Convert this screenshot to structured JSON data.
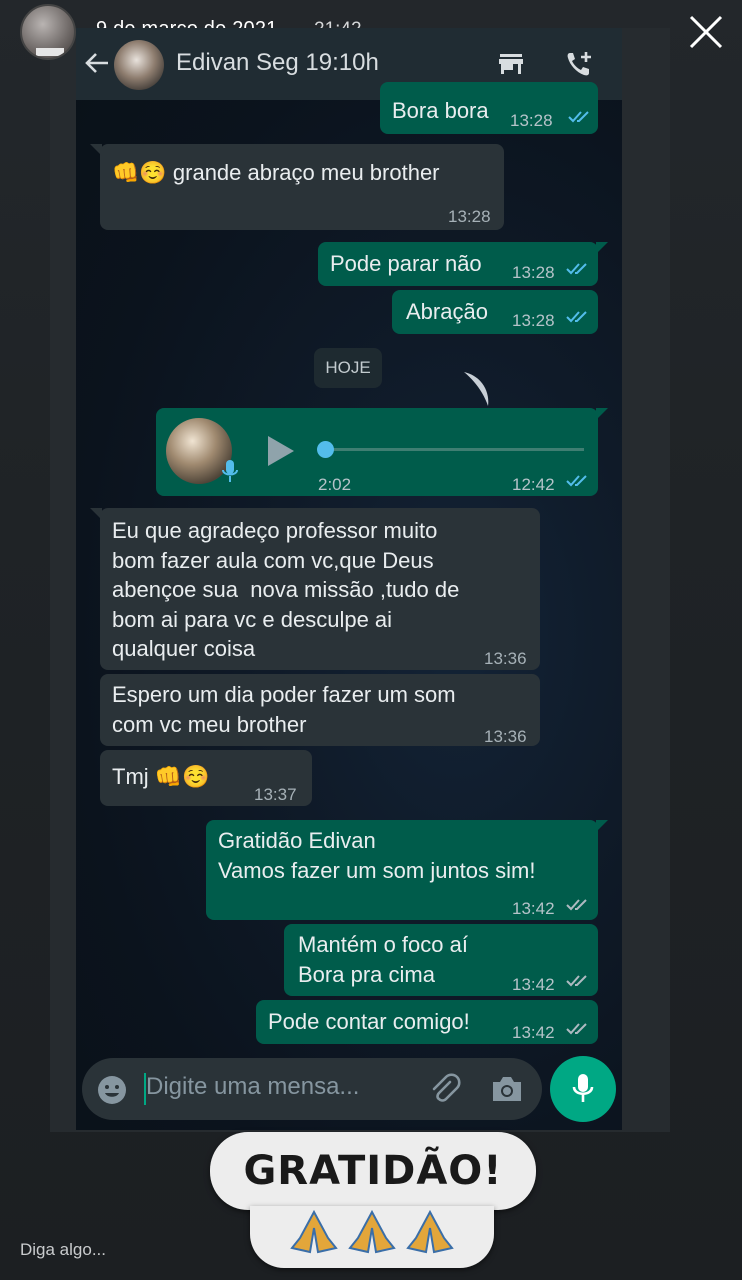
{
  "story": {
    "date": "9 de março de 2021",
    "time": "21:42",
    "reply_placeholder": "Diga algo...",
    "sticker_text": "GRATIDÃO!",
    "sticker_emoji": "🙏🙏🙏"
  },
  "chat": {
    "contact_title": "Edivan Seg 19:10h",
    "date_chip": "HOJE",
    "input_placeholder": "Digite uma mensa...",
    "messages": [
      {
        "dir": "out",
        "text": "Bora bora",
        "time": "13:28",
        "read": true
      },
      {
        "dir": "in",
        "text": "👊☺️ grande abraço meu brother",
        "time": "13:28"
      },
      {
        "dir": "out",
        "text": "Pode parar não",
        "time": "13:28",
        "read": true
      },
      {
        "dir": "out",
        "text": "Abração",
        "time": "13:28",
        "read": true
      },
      {
        "dir": "out",
        "type": "voice",
        "duration": "2:02",
        "time": "12:42",
        "read": true
      },
      {
        "dir": "in",
        "text": "Eu que agradeço professor muito\nbom fazer aula com vc,que Deus\nabençoe sua  nova missão ,tudo de\nbom ai para vc e desculpe ai\nqualquer coisa",
        "time": "13:36"
      },
      {
        "dir": "in",
        "text": "Espero um dia poder fazer um som\ncom vc meu brother",
        "time": "13:36"
      },
      {
        "dir": "in",
        "text": "Tmj 👊☺️",
        "time": "13:37"
      },
      {
        "dir": "out",
        "text": "Gratidão Edivan\nVamos fazer um som juntos sim!",
        "time": "13:42",
        "read": false
      },
      {
        "dir": "out",
        "text": "Mantém o foco aí\nBora pra cima",
        "time": "13:42",
        "read": false
      },
      {
        "dir": "out",
        "text": "Pode contar comigo!",
        "time": "13:42",
        "read": false
      }
    ]
  },
  "colors": {
    "incoming_bubble": "#2a3338",
    "outgoing_bubble": "#005c4b",
    "accent": "#00a884",
    "read_tick": "#53bdeb",
    "delivered_tick": "#aebac1"
  },
  "icons": [
    "close-icon",
    "back-arrow-icon",
    "store-icon",
    "add-call-icon",
    "more-vert-icon",
    "emoji-icon",
    "attach-icon",
    "camera-icon",
    "mic-icon",
    "play-icon"
  ]
}
